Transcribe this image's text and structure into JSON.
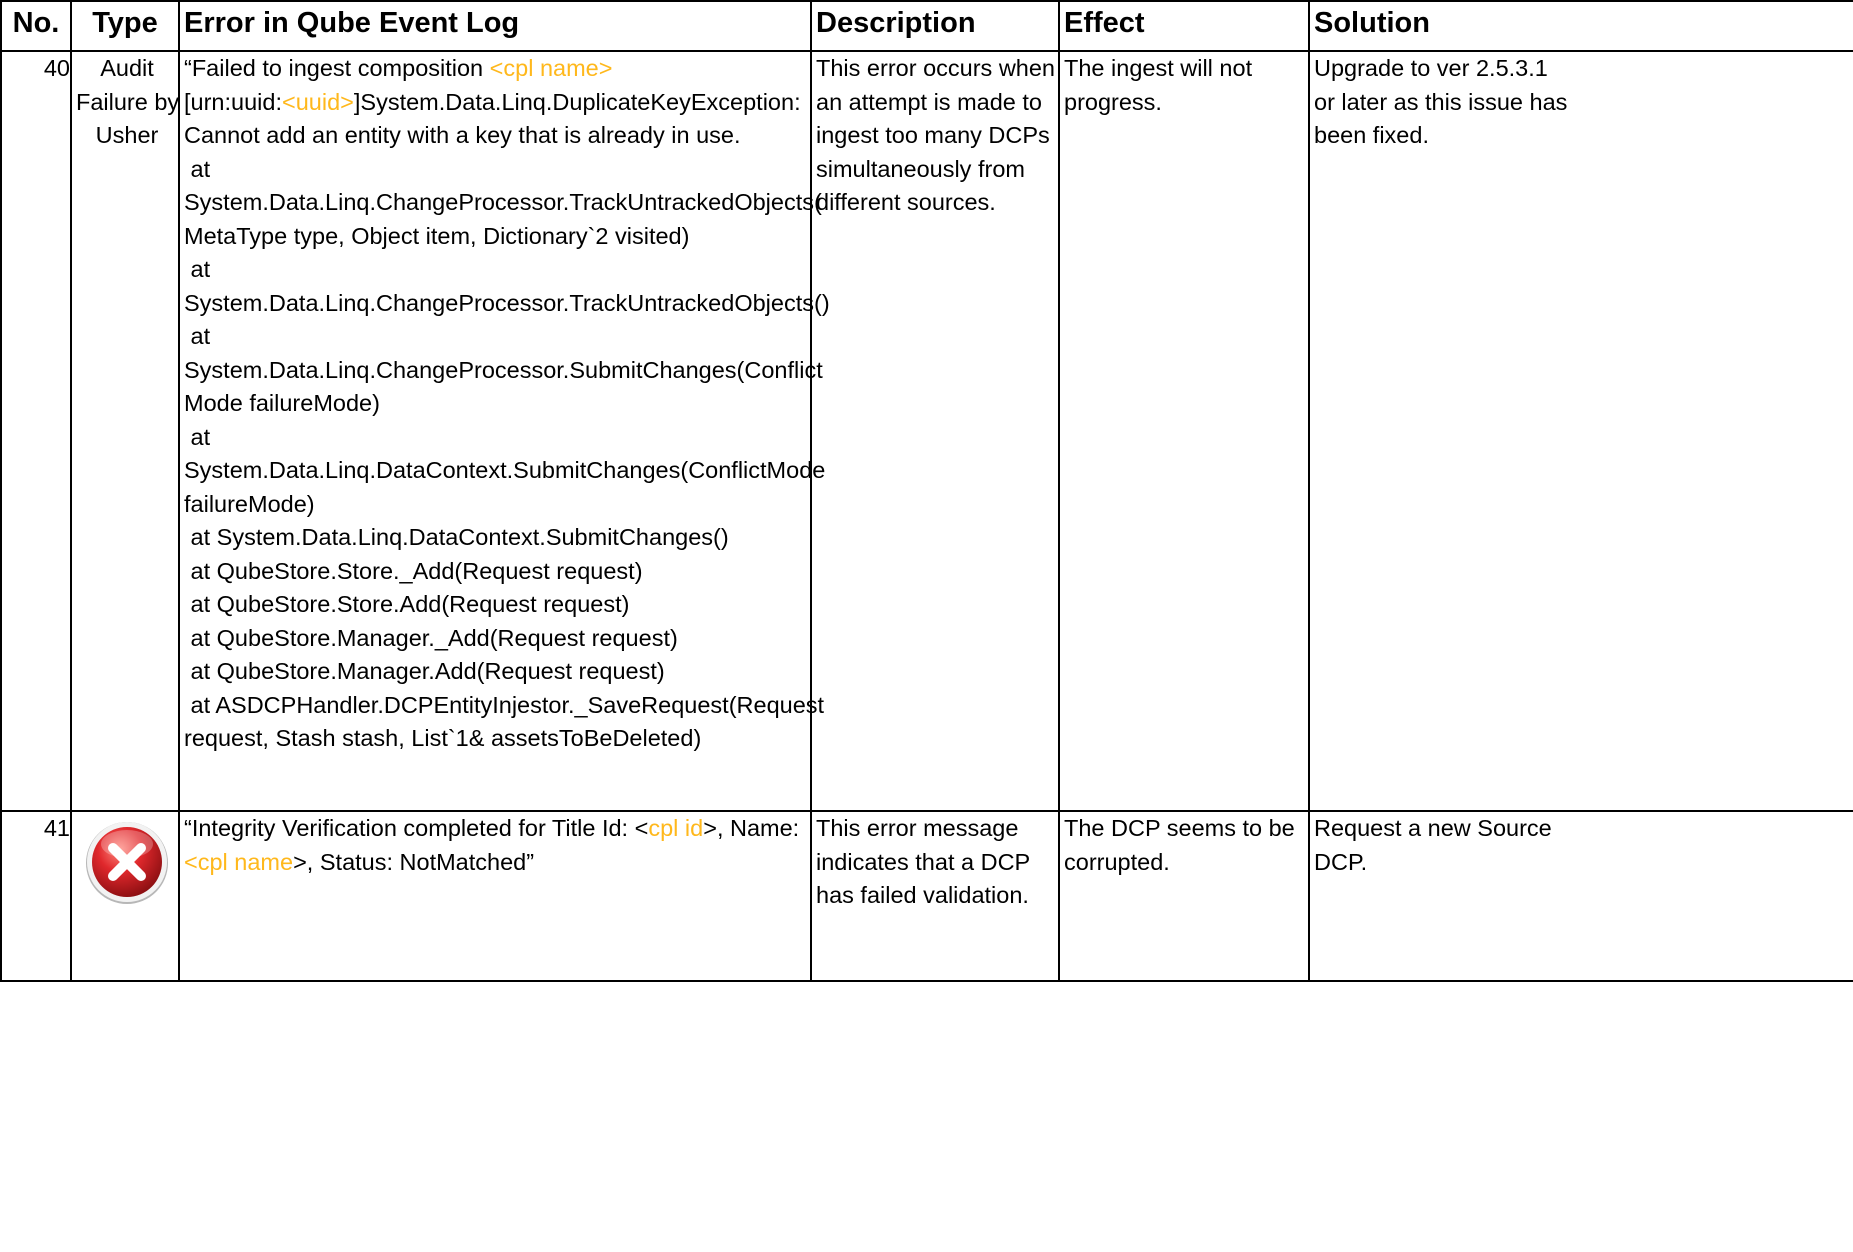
{
  "headers": {
    "no": "No.",
    "type": "Type",
    "error": "Error in Qube Event Log",
    "description": "Description",
    "effect": "Effect",
    "solution": "Solution"
  },
  "colors": {
    "placeholder": "#ffb81c",
    "border": "#000000",
    "icon_red": "#d8262a"
  },
  "rows": [
    {
      "no": "40",
      "type_lines": [
        "Audit",
        "Failure by",
        "Usher"
      ],
      "error": {
        "line1_a": "“Failed to ingest composition ",
        "line1_ph": "<cpl name>",
        "line2_a": "[urn:uuid:",
        "line2_ph": "<uuid>",
        "line2_b": "]System.Data.Linq.DuplicateKeyException:",
        "rest": [
          "Cannot add an entity with a key that is already in use.",
          " at",
          "System.Data.Linq.ChangeProcessor.TrackUntrackedObjects(",
          "MetaType type, Object item, Dictionary`2 visited)",
          " at",
          "System.Data.Linq.ChangeProcessor.TrackUntrackedObjects()",
          " at",
          "System.Data.Linq.ChangeProcessor.SubmitChanges(Conflict",
          "Mode failureMode)",
          " at",
          "System.Data.Linq.DataContext.SubmitChanges(ConflictMode",
          "failureMode)",
          " at System.Data.Linq.DataContext.SubmitChanges()",
          " at QubeStore.Store._Add(Request request)",
          " at QubeStore.Store.Add(Request request)",
          " at QubeStore.Manager._Add(Request request)",
          " at QubeStore.Manager.Add(Request request)",
          " at ASDCPHandler.DCPEntityInjestor._SaveRequest(Request",
          "request, Stash stash, List`1& assetsToBeDeleted)"
        ]
      },
      "description_lines": [
        "This error occurs when",
        "an attempt is made to",
        "ingest too many DCPs",
        "simultaneously from",
        "different sources."
      ],
      "effect_lines": [
        "The ingest will not",
        "progress."
      ],
      "solution_lines": [
        "Upgrade to ver 2.5.3.1",
        "or later as this issue has",
        "been fixed."
      ]
    },
    {
      "no": "41",
      "type_icon": "error-x-icon",
      "error": {
        "line1_a": "“Integrity Verification completed for Title Id: <",
        "line1_ph": "cpl id",
        "line1_b": ">, Name:",
        "line2_ph": "<cpl name",
        "line2_b": ">, Status: NotMatched”"
      },
      "description_lines": [
        "This error message",
        "indicates that a DCP",
        "has failed validation."
      ],
      "effect_lines": [
        "The DCP seems to be",
        "corrupted."
      ],
      "solution_lines": [
        "Request a new Source",
        "DCP."
      ]
    }
  ]
}
